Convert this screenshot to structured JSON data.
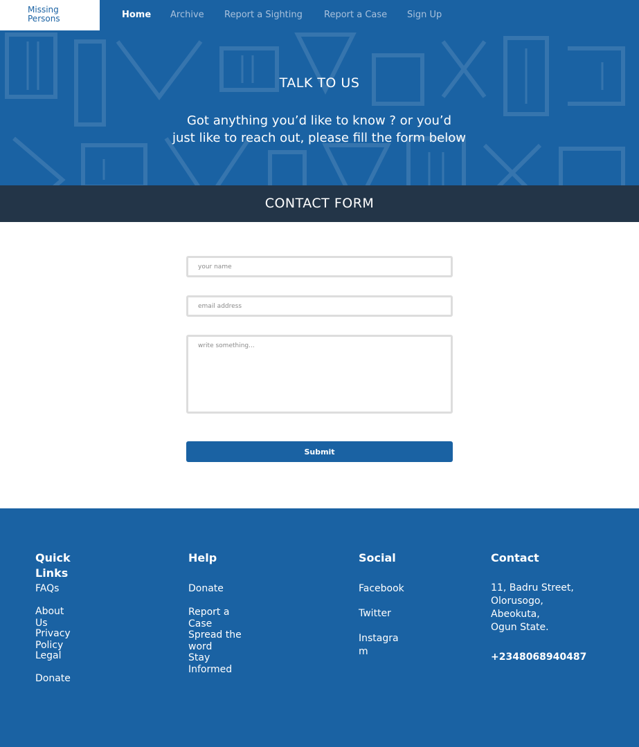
{
  "brand": {
    "line1": "Missing",
    "line2": "Persons"
  },
  "nav": {
    "items": [
      {
        "label": "Home"
      },
      {
        "label": "Archive"
      },
      {
        "label": "Report a Sighting"
      },
      {
        "label": "Report a Case"
      },
      {
        "label": "Sign Up"
      }
    ],
    "active": "Home"
  },
  "hero": {
    "title": "TALK TO US",
    "subtitle_line1": "Got anything you’d like to know ? or you’d",
    "subtitle_line2": "just like to reach out, please fill the form below"
  },
  "contact_form": {
    "title": "CONTACT FORM",
    "name_placeholder": "your name",
    "email_placeholder": "email address",
    "message_placeholder": "write something...",
    "submit_label": "Submit"
  },
  "footer": {
    "quick_links": {
      "heading_line1": "Quick",
      "heading_line2": "Links",
      "faqs": "FAQs",
      "about_line1": "About",
      "about_line2": "Us",
      "privacy_line1": "Privacy",
      "privacy_line2": "Policy",
      "legal": "Legal",
      "donate": "Donate"
    },
    "help": {
      "heading": "Help",
      "donate": "Donate",
      "report_line1": "Report a",
      "report_line2": "Case",
      "spread_line1": "Spread the",
      "spread_line2": "word",
      "stay_line1": "Stay",
      "stay_line2": "Informed"
    },
    "social": {
      "heading": "Social",
      "facebook": "Facebook",
      "twitter": "Twitter",
      "instagram_line1": "Instagra",
      "instagram_line2": "m"
    },
    "contact": {
      "heading": "Contact",
      "address_line1": "11, Badru Street,",
      "address_line2": "Olorusogo,",
      "address_line3": "Abeokuta,",
      "address_line4": "Ogun State.",
      "phone": "+2348068940487"
    }
  },
  "colors": {
    "primary": "#1a62a3",
    "band": "#233548",
    "nav_inactive": "#a9c1dc",
    "field_border": "#dddddd"
  }
}
